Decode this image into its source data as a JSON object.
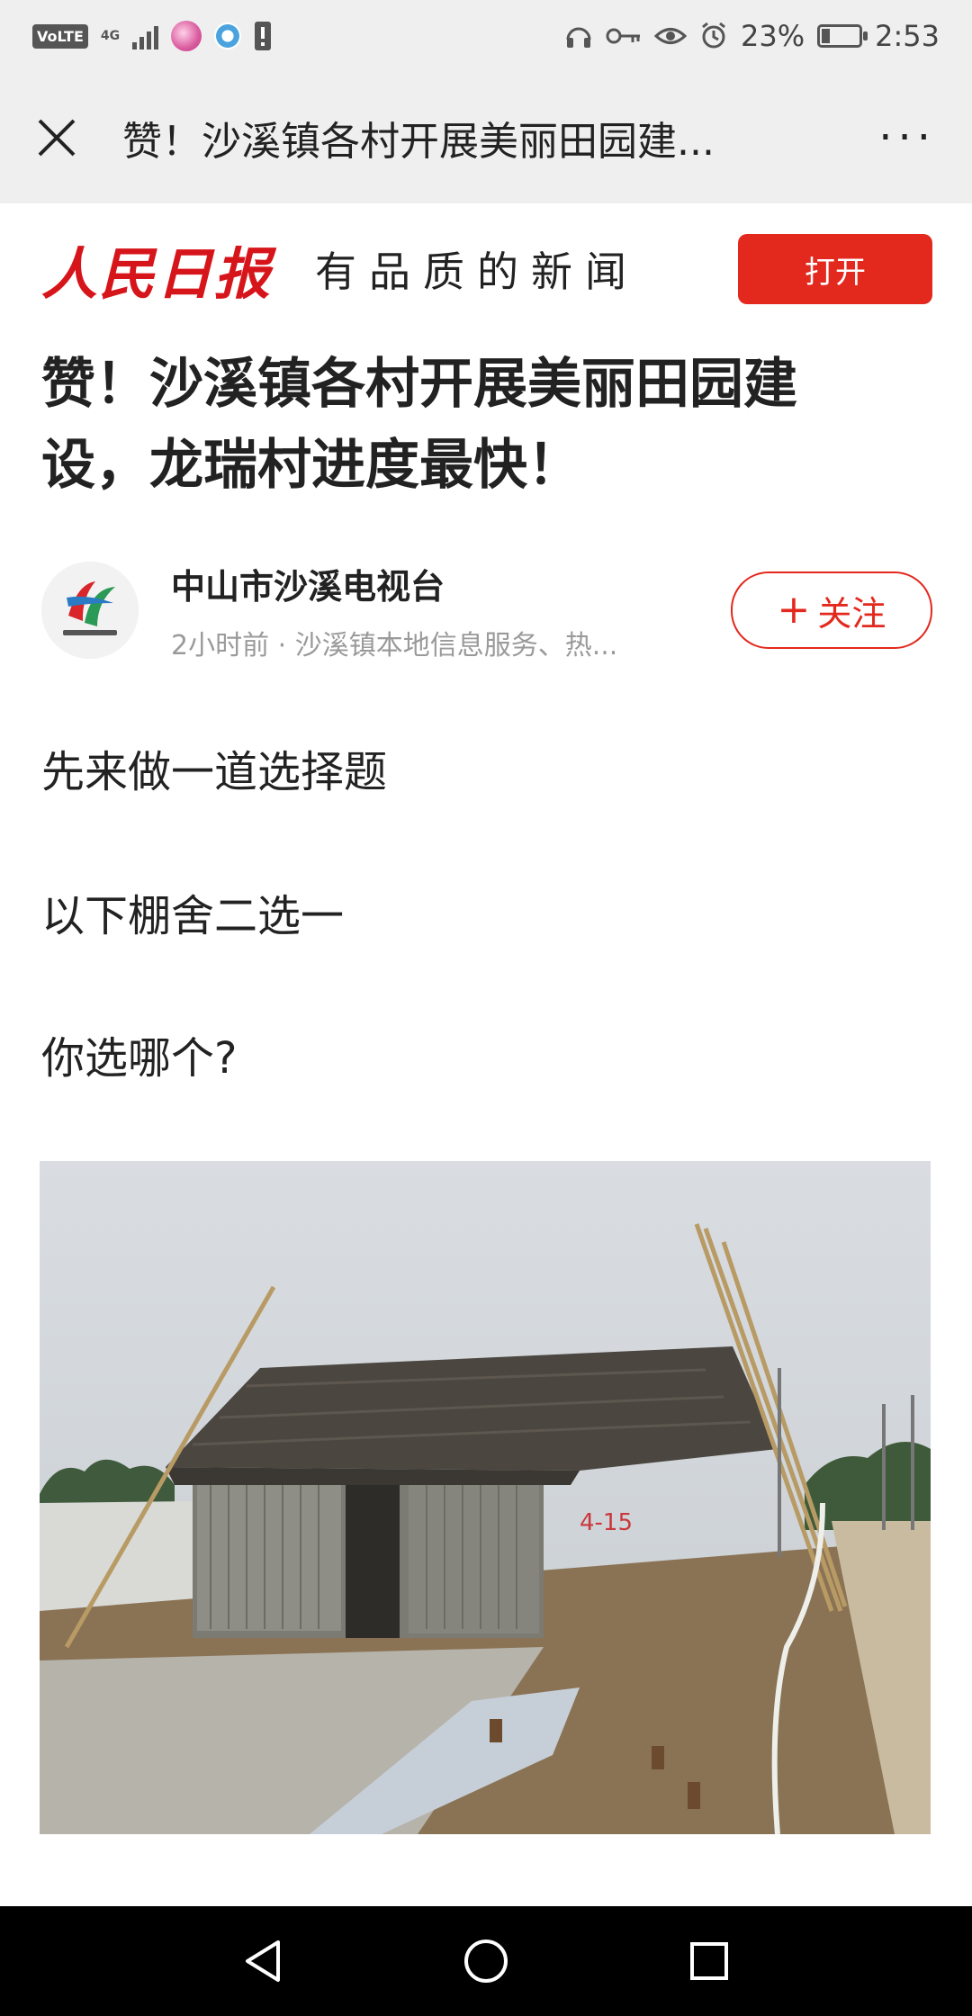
{
  "status_bar": {
    "volte": "VoLTE",
    "network": "4G",
    "percent": "23%",
    "time": "2:53",
    "battery_level": 0.23
  },
  "nav": {
    "title": "赞！沙溪镇各村开展美丽田园建...",
    "more": "···"
  },
  "brand": {
    "logo": "人民日报",
    "slogan": "有品质的新闻",
    "open_label": "打开",
    "accent": "#e3281d"
  },
  "article": {
    "headline_line1": "赞！沙溪镇各村开展美丽田园建",
    "headline_line2": "设，龙瑞村进度最快！",
    "author": {
      "name": "中山市沙溪电视台",
      "meta": "2小时前 · 沙溪镇本地信息服务、热...",
      "follow_label": "关注"
    },
    "paragraphs": [
      "先来做一道选择题",
      "以下棚舍二选一",
      "你选哪个?"
    ],
    "photo_marking": "4-15"
  }
}
